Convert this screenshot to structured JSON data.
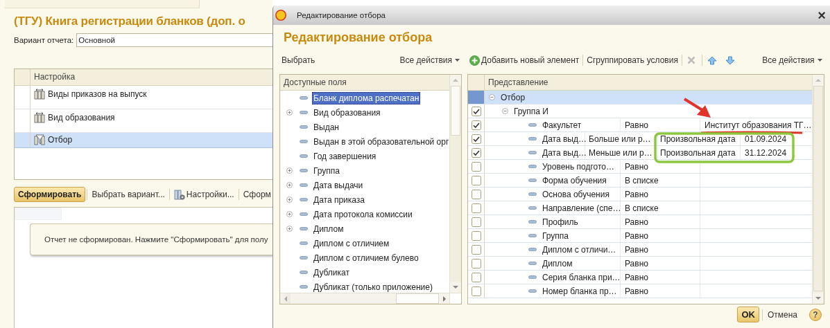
{
  "report_window": {
    "title": "(ТГУ) Книга регистрации бланков (доп. о",
    "variant": {
      "label": "Вариант отчета:",
      "value": "Основной"
    },
    "settings_table": {
      "column": "Настройка",
      "rows": [
        {
          "label": "Виды приказов на выпуск",
          "kind": "grouping",
          "selected": false
        },
        {
          "label": "Вид образования",
          "kind": "grouping",
          "selected": false
        },
        {
          "label": "Отбор",
          "kind": "filter",
          "selected": true
        }
      ]
    },
    "toolbar": [
      {
        "label": "Сформировать",
        "kind": "default"
      },
      {
        "label": "Выбрать вариант...",
        "kind": "plain"
      },
      {
        "label": "Настройки...",
        "kind": "settings"
      },
      {
        "label": "Сформ",
        "kind": "plain"
      }
    ],
    "message": "Отчет не сформирован. Нажмите \"Сформировать\" для полу"
  },
  "dialog": {
    "window_title": "Редактирование отбора",
    "close": "×",
    "heading": "Редактирование отбора",
    "fields_panel": {
      "select": "Выбрать",
      "all_actions": "Все действия",
      "column": "Доступные поля",
      "items": [
        {
          "label": "Бланк диплома распечатан",
          "kind": "field",
          "selected": true
        },
        {
          "label": "Вид образования",
          "kind": "group",
          "selected": false
        },
        {
          "label": "Выдан",
          "kind": "field",
          "selected": false
        },
        {
          "label": "Выдан в этой образовательной орг",
          "kind": "field",
          "selected": false
        },
        {
          "label": "Год завершения",
          "kind": "field",
          "selected": false
        },
        {
          "label": "Группа",
          "kind": "group",
          "selected": false
        },
        {
          "label": "Дата выдачи",
          "kind": "group",
          "selected": false
        },
        {
          "label": "Дата приказа",
          "kind": "group",
          "selected": false
        },
        {
          "label": "Дата протокола комиссии",
          "kind": "group",
          "selected": false
        },
        {
          "label": "Диплом",
          "kind": "group",
          "selected": false
        },
        {
          "label": "Диплом с отличием",
          "kind": "field",
          "selected": false
        },
        {
          "label": "Диплом с отличием булево",
          "kind": "field",
          "selected": false
        },
        {
          "label": "Дубликат",
          "kind": "field",
          "selected": false
        },
        {
          "label": "Дубликат (только приложение)",
          "kind": "field",
          "selected": false
        }
      ]
    },
    "filter_panel": {
      "toolbar": [
        {
          "label": "Добавить новый элемент",
          "kind": "add"
        },
        {
          "label": "Сгруппировать условия",
          "kind": "text"
        },
        {
          "kind": "delete"
        },
        {
          "kind": "up"
        },
        {
          "kind": "down"
        }
      ],
      "all_actions": "Все действия",
      "column": "Представление",
      "tree": [
        {
          "label": "Отбор",
          "expanded": true,
          "selected": true,
          "children": [
            {
              "label": "Группа И",
              "checked": true,
              "expanded": true,
              "selected": false,
              "conditions": [
                {
                  "field": "Факультет",
                  "comparison": "Равно",
                  "value": "Институт образования ТГ…",
                  "checked": true,
                  "selected": false
                },
                {
                  "field": "Дата выд…",
                  "comparison": "Больше или р…",
                  "value_type": "Произвольная дата",
                  "value": "01.09.2024",
                  "checked": true,
                  "selected": false
                },
                {
                  "field": "Дата выд…",
                  "comparison": "Меньше или р…",
                  "value_type": "Произвольная дата",
                  "value": "31.12.2024",
                  "checked": true,
                  "selected": false
                },
                {
                  "field": "Уровень подгото…",
                  "comparison": "Равно",
                  "checked": false,
                  "selected": false
                },
                {
                  "field": "Форма обучения",
                  "comparison": "В списке",
                  "checked": false,
                  "selected": false
                },
                {
                  "field": "Основа обучения",
                  "comparison": "Равно",
                  "checked": false,
                  "selected": false
                },
                {
                  "field": "Направление (спе…",
                  "comparison": "В списке",
                  "checked": false,
                  "selected": false
                },
                {
                  "field": "Профиль",
                  "comparison": "Равно",
                  "checked": false,
                  "selected": false
                },
                {
                  "field": "Группа",
                  "comparison": "Равно",
                  "checked": false,
                  "selected": false
                },
                {
                  "field": "Диплом с отличи…",
                  "comparison": "Равно",
                  "checked": false,
                  "selected": false
                },
                {
                  "field": "Диплом",
                  "comparison": "Равно",
                  "checked": false,
                  "selected": false
                },
                {
                  "field": "Серия бланка при…",
                  "comparison": "Равно",
                  "checked": false,
                  "selected": false
                },
                {
                  "field": "Номер бланка пр…",
                  "comparison": "Равно",
                  "checked": false,
                  "selected": false
                }
              ]
            }
          ]
        }
      ]
    },
    "footer": {
      "ok": "OK",
      "cancel": "Отмена",
      "help": "?"
    }
  }
}
